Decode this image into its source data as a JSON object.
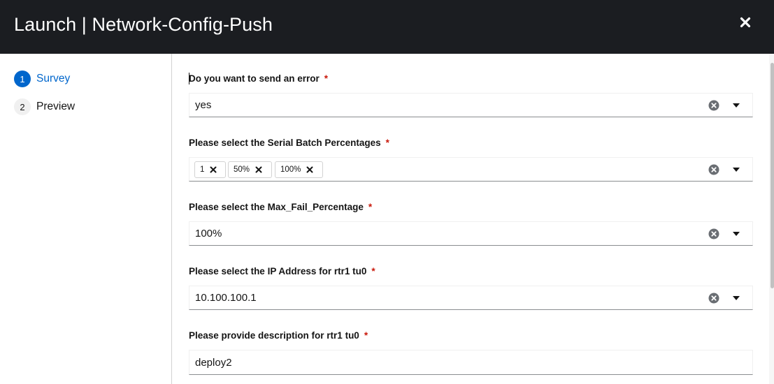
{
  "header": {
    "title": "Launch | Network-Config-Push"
  },
  "steps": [
    {
      "number": "1",
      "label": "Survey",
      "active": true
    },
    {
      "number": "2",
      "label": "Preview",
      "active": false
    }
  ],
  "required_marker": "*",
  "fields": {
    "send_error": {
      "label": "Do you want to send an error",
      "value": "yes"
    },
    "serial_batch": {
      "label": "Please select the Serial Batch Percentages",
      "chips": [
        "1",
        "50%",
        "100%"
      ]
    },
    "max_fail": {
      "label": "Please select the Max_Fail_Percentage",
      "value": "100%"
    },
    "ip_address": {
      "label": "Please select the IP Address for rtr1 tu0",
      "value": "10.100.100.1"
    },
    "description": {
      "label": "Please provide description for rtr1 tu0",
      "value": "deploy2"
    }
  },
  "colors": {
    "header_bg": "#1b1d21",
    "accent": "#0066cc",
    "required": "#c9190b"
  },
  "icons": {
    "close": "close-icon",
    "clear": "clear-circle-icon",
    "toggle": "caret-down-icon",
    "chip_remove": "chip-remove-icon"
  }
}
